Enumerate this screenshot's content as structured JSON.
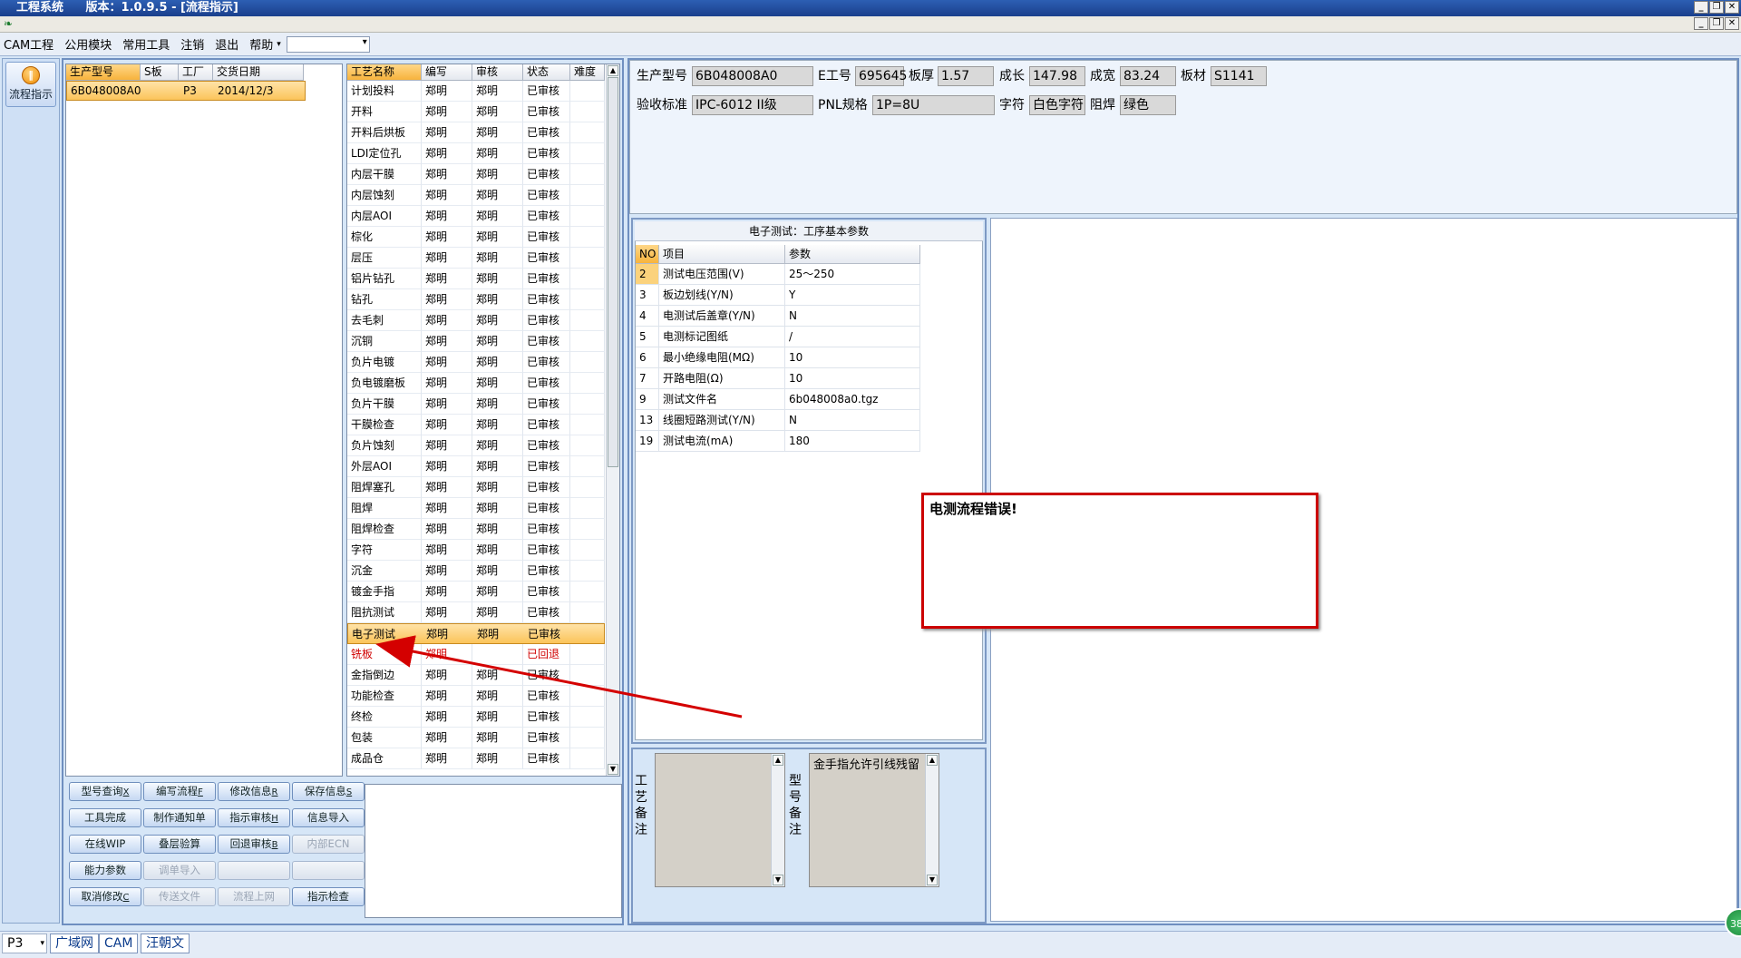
{
  "window": {
    "app_title": "工程系统",
    "version_title": "版本：1.0.9.5 - [流程指示]"
  },
  "menu": [
    "CAM工程",
    "公用模块",
    "常用工具",
    "注销",
    "退出",
    "帮助"
  ],
  "nav": {
    "flow_button": "流程指示"
  },
  "orders": {
    "headers": [
      "生产型号",
      "S板",
      "工厂",
      "交货日期"
    ],
    "rows": [
      [
        "6B048008A0",
        "",
        "P3",
        "2014/12/3"
      ]
    ]
  },
  "process": {
    "headers": [
      "工艺名称",
      "编写",
      "审核",
      "状态",
      "难度"
    ],
    "rows": [
      [
        "计划投料",
        "郑明",
        "郑明",
        "已审核",
        ""
      ],
      [
        "开料",
        "郑明",
        "郑明",
        "已审核",
        ""
      ],
      [
        "开料后烘板",
        "郑明",
        "郑明",
        "已审核",
        ""
      ],
      [
        "LDI定位孔",
        "郑明",
        "郑明",
        "已审核",
        ""
      ],
      [
        "内层干膜",
        "郑明",
        "郑明",
        "已审核",
        ""
      ],
      [
        "内层蚀刻",
        "郑明",
        "郑明",
        "已审核",
        ""
      ],
      [
        "内层AOI",
        "郑明",
        "郑明",
        "已审核",
        ""
      ],
      [
        "棕化",
        "郑明",
        "郑明",
        "已审核",
        ""
      ],
      [
        "层压",
        "郑明",
        "郑明",
        "已审核",
        ""
      ],
      [
        "铝片钻孔",
        "郑明",
        "郑明",
        "已审核",
        ""
      ],
      [
        "钻孔",
        "郑明",
        "郑明",
        "已审核",
        ""
      ],
      [
        "去毛刺",
        "郑明",
        "郑明",
        "已审核",
        ""
      ],
      [
        "沉铜",
        "郑明",
        "郑明",
        "已审核",
        ""
      ],
      [
        "负片电镀",
        "郑明",
        "郑明",
        "已审核",
        ""
      ],
      [
        "负电镀磨板",
        "郑明",
        "郑明",
        "已审核",
        ""
      ],
      [
        "负片干膜",
        "郑明",
        "郑明",
        "已审核",
        ""
      ],
      [
        "干膜检查",
        "郑明",
        "郑明",
        "已审核",
        ""
      ],
      [
        "负片蚀刻",
        "郑明",
        "郑明",
        "已审核",
        ""
      ],
      [
        "外层AOI",
        "郑明",
        "郑明",
        "已审核",
        ""
      ],
      [
        "阻焊塞孔",
        "郑明",
        "郑明",
        "已审核",
        ""
      ],
      [
        "阻焊",
        "郑明",
        "郑明",
        "已审核",
        ""
      ],
      [
        "阻焊检查",
        "郑明",
        "郑明",
        "已审核",
        ""
      ],
      [
        "字符",
        "郑明",
        "郑明",
        "已审核",
        ""
      ],
      [
        "沉金",
        "郑明",
        "郑明",
        "已审核",
        ""
      ],
      [
        "镀金手指",
        "郑明",
        "郑明",
        "已审核",
        ""
      ],
      [
        "阻抗测试",
        "郑明",
        "郑明",
        "已审核",
        ""
      ],
      [
        "电子测试",
        "郑明",
        "郑明",
        "已审核",
        ""
      ],
      [
        "铣板",
        "郑明",
        "",
        "已回退",
        ""
      ],
      [
        "金指倒边",
        "郑明",
        "郑明",
        "已审核",
        ""
      ],
      [
        "功能检查",
        "郑明",
        "郑明",
        "已审核",
        ""
      ],
      [
        "终检",
        "郑明",
        "郑明",
        "已审核",
        ""
      ],
      [
        "包装",
        "郑明",
        "郑明",
        "已审核",
        ""
      ],
      [
        "成品仓",
        "郑明",
        "郑明",
        "已审核",
        ""
      ]
    ],
    "selected_index": 26,
    "returned_index": 27
  },
  "buttons": [
    [
      "型号查询",
      "X"
    ],
    [
      "编写流程",
      "F"
    ],
    [
      "修改信息",
      "R"
    ],
    [
      "保存信息",
      "S"
    ],
    [
      "工具完成",
      ""
    ],
    [
      "制作通知单",
      ""
    ],
    [
      "指示审核",
      "H"
    ],
    [
      "信息导入",
      ""
    ],
    [
      "在线WIP",
      ""
    ],
    [
      "叠层验算",
      ""
    ],
    [
      "回退审核",
      "B"
    ],
    [
      "内部ECN",
      ""
    ],
    [
      "能力参数",
      ""
    ],
    [
      "调单导入",
      ""
    ],
    [
      "",
      ""
    ],
    [
      "",
      ""
    ],
    [
      "取消修改",
      "C"
    ],
    [
      "传送文件",
      ""
    ],
    [
      "流程上网",
      ""
    ],
    [
      "指示检查",
      ""
    ]
  ],
  "disabled_buttons": [
    11,
    13,
    14,
    15,
    17,
    18
  ],
  "info": {
    "model_label": "生产型号",
    "model": "6B048008A0",
    "eng_label": "E工号",
    "eng": "695645",
    "thick_label": "板厚",
    "thick": "1.57",
    "len_label": "成长",
    "len": "147.98",
    "width_label": "成宽",
    "width": "83.24",
    "mat_label": "板材",
    "mat": "S1141",
    "std_label": "验收标准",
    "std": "IPC-6012 II级",
    "pnl_label": "PNL规格",
    "pnl": "1P=8U",
    "char_label": "字符",
    "char": "白色字符",
    "mask_label": "阻焊",
    "mask": "绿色"
  },
  "params": {
    "title": "电子测试：工序基本参数",
    "headers": [
      "NO",
      "项目",
      "参数"
    ],
    "rows": [
      [
        "2",
        "测试电压范围(V)",
        "25～250"
      ],
      [
        "3",
        "板边划线(Y/N)",
        "Y"
      ],
      [
        "4",
        "电测试后盖章(Y/N)",
        "N"
      ],
      [
        "5",
        "电测标记图纸",
        "/"
      ],
      [
        "6",
        "最小绝缘电阻(MΩ)",
        "10"
      ],
      [
        "7",
        "开路电阻(Ω)",
        "10"
      ],
      [
        "9",
        "测试文件名",
        "6b048008a0.tgz"
      ],
      [
        "13",
        "线圈短路测试(Y/N)",
        "N"
      ],
      [
        "19",
        "测试电流(mA)",
        "180"
      ]
    ]
  },
  "remarks": {
    "process_label": "工艺备注",
    "model_label": "型号备注",
    "model_text": "金手指允许引线残留"
  },
  "error_box": {
    "text": "电测流程错误!"
  },
  "status": {
    "factory": "P3",
    "items": [
      "广域网",
      "CAM",
      "汪朝文"
    ],
    "badge": "38"
  },
  "colors": {
    "accent": "#f7b33c",
    "error_red": "#cc0000",
    "titlebar": "#1a3f8c"
  }
}
